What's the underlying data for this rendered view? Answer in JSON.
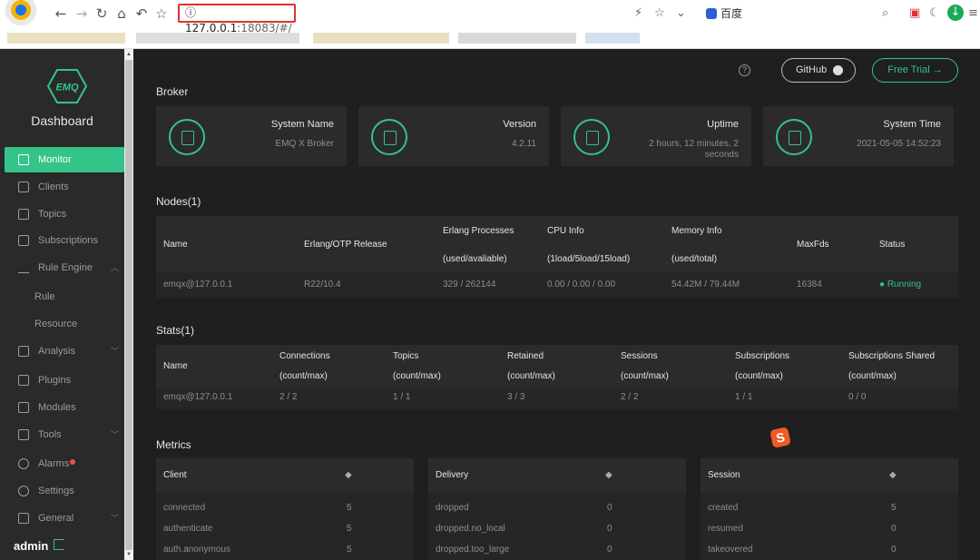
{
  "browser": {
    "url_host": "127.0.0.1",
    "url_rest": ":18083/#/",
    "search_placeholder": "百度"
  },
  "sidebar": {
    "brand": "Dashboard",
    "logo_text": "EMQ",
    "items": [
      {
        "label": "Monitor",
        "icon": "monitor-icon"
      },
      {
        "label": "Clients",
        "icon": "clients-icon"
      },
      {
        "label": "Topics",
        "icon": "topics-icon"
      },
      {
        "label": "Subscriptions",
        "icon": "subscriptions-icon"
      },
      {
        "label": "Rule Engine",
        "icon": "rule-engine-icon"
      },
      {
        "label": "Rule"
      },
      {
        "label": "Resource"
      },
      {
        "label": "Analysis",
        "icon": "analysis-icon"
      },
      {
        "label": "Plugins",
        "icon": "plugins-icon"
      },
      {
        "label": "Modules",
        "icon": "modules-icon"
      },
      {
        "label": "Tools",
        "icon": "tools-icon"
      },
      {
        "label": "Alarms",
        "icon": "alarms-icon"
      },
      {
        "label": "Settings",
        "icon": "settings-icon"
      },
      {
        "label": "General",
        "icon": "general-icon"
      }
    ],
    "user": "admin"
  },
  "header": {
    "help": "?",
    "github_label": "GitHub",
    "trial_label": "Free Trial →"
  },
  "broker": {
    "title": "Broker",
    "cards": [
      {
        "label": "System Name",
        "value": "EMQ X Broker"
      },
      {
        "label": "Version",
        "value": "4.2.11"
      },
      {
        "label": "Uptime",
        "value": "2 hours, 12 minutes, 2 seconds"
      },
      {
        "label": "System Time",
        "value": "2021-05-05 14:52:23"
      }
    ]
  },
  "nodes": {
    "title": "Nodes(1)",
    "headers": {
      "name": "Name",
      "otp": "Erlang/OTP Release",
      "processes": "Erlang Processes",
      "processes_sub": "(used/avaliable)",
      "cpu": "CPU Info",
      "cpu_sub": "(1load/5load/15load)",
      "memory": "Memory Info",
      "memory_sub": "(used/total)",
      "maxfds": "MaxFds",
      "status": "Status"
    },
    "row": {
      "name": "emqx@127.0.0.1",
      "otp": "R22/10.4",
      "processes": "329 / 262144",
      "cpu": "0.00 / 0.00 / 0.00",
      "memory": "54.42M / 79.44M",
      "maxfds": "16384",
      "status": "● Running"
    }
  },
  "stats": {
    "title": "Stats(1)",
    "headers": {
      "name": "Name",
      "connections": "Connections",
      "topics": "Topics",
      "retained": "Retained",
      "sessions": "Sessions",
      "subscriptions": "Subscriptions",
      "subscriptions_shared": "Subscriptions Shared",
      "count_max": "(count/max)"
    },
    "row": {
      "name": "emqx@127.0.0.1",
      "connections": "2 / 2",
      "topics": "1 / 1",
      "retained": "3 / 3",
      "sessions": "2 / 2",
      "subscriptions": "1 / 1",
      "subscriptions_shared": "0 / 0"
    }
  },
  "metrics": {
    "title": "Metrics",
    "sort_symbol": "◆",
    "boxes": [
      {
        "head": "Client",
        "rows": [
          [
            "connected",
            "5"
          ],
          [
            "authenticate",
            "5"
          ],
          [
            "auth.anonymous",
            "5"
          ]
        ]
      },
      {
        "head": "Delivery",
        "rows": [
          [
            "dropped",
            "0"
          ],
          [
            "dropped.no_local",
            "0"
          ],
          [
            "dropped.too_large",
            "0"
          ]
        ]
      },
      {
        "head": "Session",
        "rows": [
          [
            "created",
            "5"
          ],
          [
            "resumed",
            "0"
          ],
          [
            "takeovered",
            "0"
          ]
        ]
      }
    ]
  },
  "overlay": {
    "sogou": "S"
  }
}
